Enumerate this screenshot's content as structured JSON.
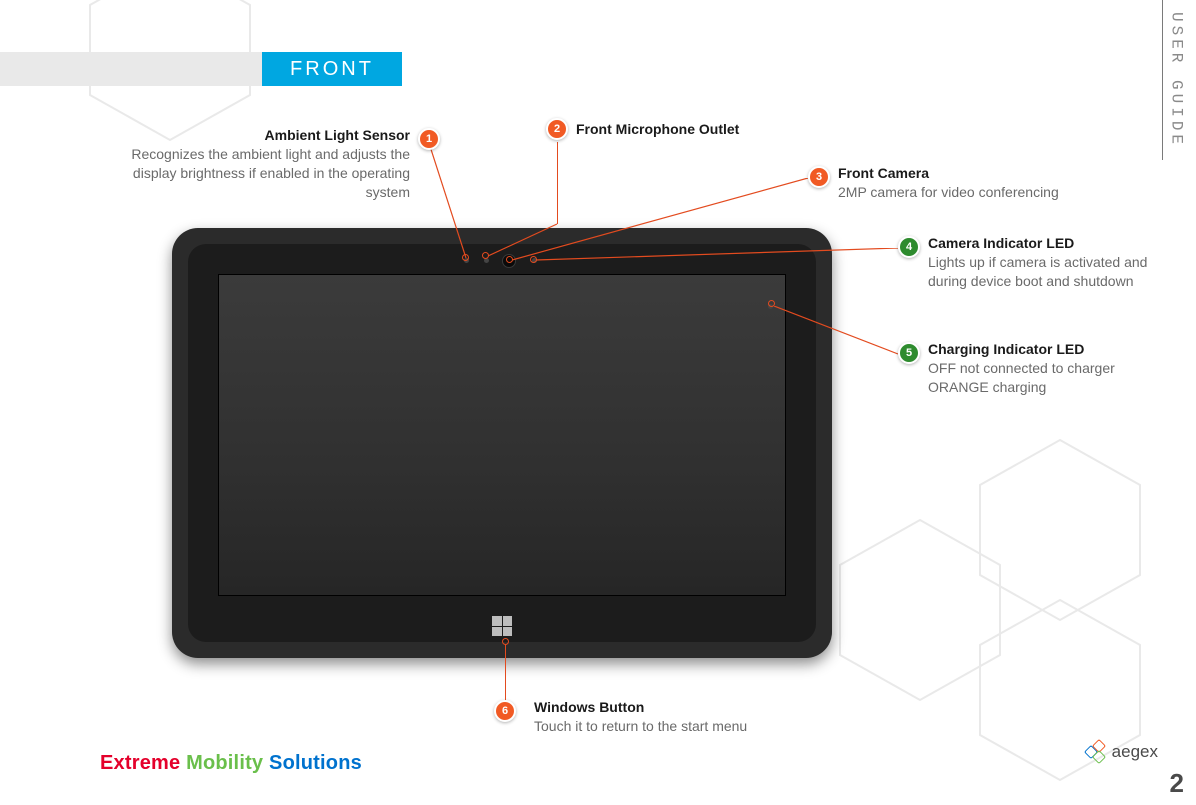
{
  "header": {
    "section_title": "FRONT",
    "side_label": "USER GUIDE",
    "page_number": "2"
  },
  "callouts": {
    "c1": {
      "num": "1",
      "title": "Ambient Light Sensor",
      "desc": "Recognizes the ambient light and adjusts the display brightness if enabled in the operating system"
    },
    "c2": {
      "num": "2",
      "title": "Front Microphone Outlet",
      "desc": ""
    },
    "c3": {
      "num": "3",
      "title": "Front Camera",
      "desc": "2MP camera for video conferencing"
    },
    "c4": {
      "num": "4",
      "title": "Camera Indicator LED",
      "desc": "Lights up if camera is activated and during device boot and shutdown"
    },
    "c5": {
      "num": "5",
      "title": "Charging Indicator LED",
      "desc_line1": "OFF not connected to charger",
      "desc_line2": "ORANGE charging"
    },
    "c6": {
      "num": "6",
      "title": "Windows Button",
      "desc": "Touch it to return to the start menu"
    }
  },
  "footer": {
    "brand_w1": "Extreme",
    "brand_w2": "Mobility",
    "brand_w3": "Solutions",
    "logo_text": "aegex"
  }
}
